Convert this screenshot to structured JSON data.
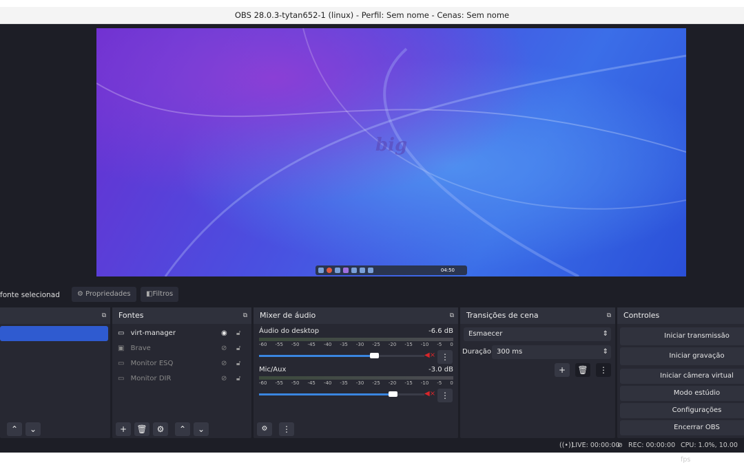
{
  "window": {
    "title": "OBS 28.0.3-tytan652-1 (linux) - Perfil: Sem nome - Cenas: Sem nome"
  },
  "preview": {
    "logo": "big",
    "clock": "04:50"
  },
  "source_toolbar": {
    "no_source": "fonte selecionad",
    "properties": "Propriedades",
    "filters": "Filtros"
  },
  "sources": {
    "title": "Fontes",
    "items": [
      {
        "name": "virt-manager",
        "icon": "monitor-icon",
        "visible": true
      },
      {
        "name": "Brave",
        "icon": "window-icon",
        "visible": false
      },
      {
        "name": "Monitor ESQ",
        "icon": "monitor-icon",
        "visible": false
      },
      {
        "name": "Monitor DIR",
        "icon": "monitor-icon",
        "visible": false
      }
    ]
  },
  "mixer": {
    "title": "Mixer de áudio",
    "ticks": [
      "-60",
      "-55",
      "-50",
      "-45",
      "-40",
      "-35",
      "-30",
      "-25",
      "-20",
      "-15",
      "-10",
      "-5",
      "0"
    ],
    "channels": [
      {
        "name": "Áudio do desktop",
        "level": "-6.6 dB",
        "volume_pct": 74
      },
      {
        "name": "Mic/Aux",
        "level": "-3.0 dB",
        "volume_pct": 86
      }
    ]
  },
  "transitions": {
    "title": "Transições de cena",
    "type": "Esmaecer",
    "duration_label": "Duração",
    "duration": "300 ms"
  },
  "controls": {
    "title": "Controles",
    "buttons": [
      "Iniciar transmissão",
      "Iniciar gravação",
      "Iniciar câmera virtual",
      "Modo estúdio",
      "Configurações",
      "Encerrar OBS"
    ]
  },
  "status": {
    "live": "LIVE: 00:00:00",
    "rec": "REC: 00:00:00",
    "cpu": "CPU: 1.0%, 10.00 fps"
  },
  "colors": {
    "accent": "#2f5bd0",
    "slider": "#3a86e0",
    "mute": "#d8262a"
  }
}
